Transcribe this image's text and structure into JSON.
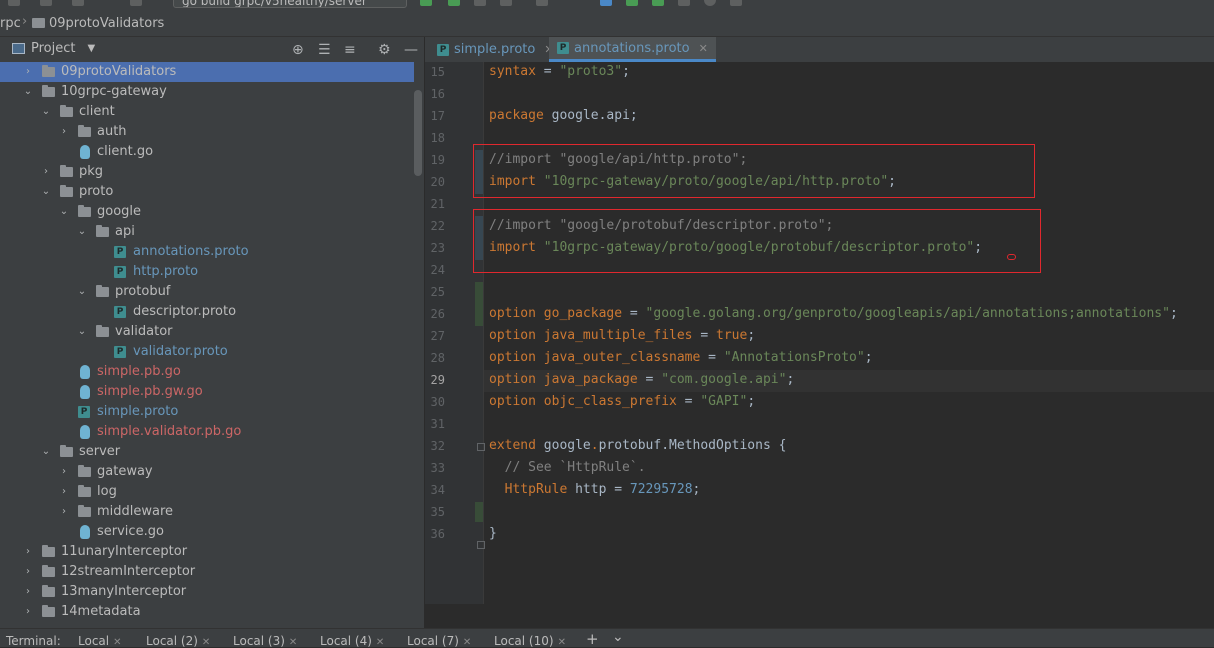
{
  "toolbar": {
    "crumb_root": "rpc",
    "crumb_folder": "09protoValidators",
    "run_config": "go build grpc/v5healthy/server"
  },
  "project_panel": {
    "title": "Project"
  },
  "tree": [
    {
      "label": "09protoValidators",
      "kind": "folder",
      "expanded": false,
      "color": "default",
      "selected": true
    },
    {
      "label": "10grpc-gateway",
      "kind": "folder",
      "expanded": true,
      "color": "default"
    },
    {
      "label": "client",
      "kind": "folder",
      "expanded": true,
      "color": "default"
    },
    {
      "label": "auth",
      "kind": "folder",
      "expanded": false,
      "color": "default"
    },
    {
      "label": "client.go",
      "kind": "go",
      "color": "default"
    },
    {
      "label": "pkg",
      "kind": "folder",
      "expanded": false,
      "color": "default"
    },
    {
      "label": "proto",
      "kind": "folder",
      "expanded": true,
      "color": "default"
    },
    {
      "label": "google",
      "kind": "folder",
      "expanded": true,
      "color": "default"
    },
    {
      "label": "api",
      "kind": "folder",
      "expanded": true,
      "color": "default"
    },
    {
      "label": "annotations.proto",
      "kind": "proto",
      "color": "blue"
    },
    {
      "label": "http.proto",
      "kind": "proto",
      "color": "blue"
    },
    {
      "label": "protobuf",
      "kind": "folder",
      "expanded": true,
      "color": "default"
    },
    {
      "label": "descriptor.proto",
      "kind": "proto",
      "color": "default"
    },
    {
      "label": "validator",
      "kind": "folder",
      "expanded": true,
      "color": "default"
    },
    {
      "label": "validator.proto",
      "kind": "proto",
      "color": "blue"
    },
    {
      "label": "simple.pb.go",
      "kind": "go",
      "color": "red"
    },
    {
      "label": "simple.pb.gw.go",
      "kind": "go",
      "color": "red"
    },
    {
      "label": "simple.proto",
      "kind": "proto",
      "color": "blue"
    },
    {
      "label": "simple.validator.pb.go",
      "kind": "go",
      "color": "red"
    },
    {
      "label": "server",
      "kind": "folder",
      "expanded": true,
      "color": "default"
    },
    {
      "label": "gateway",
      "kind": "folder",
      "expanded": false,
      "color": "default"
    },
    {
      "label": "log",
      "kind": "folder",
      "expanded": false,
      "color": "default"
    },
    {
      "label": "middleware",
      "kind": "folder",
      "expanded": false,
      "color": "default"
    },
    {
      "label": "service.go",
      "kind": "go",
      "color": "default"
    },
    {
      "label": "11unaryInterceptor",
      "kind": "folder",
      "expanded": false,
      "color": "default"
    },
    {
      "label": "12streamInterceptor",
      "kind": "folder",
      "expanded": false,
      "color": "default"
    },
    {
      "label": "13manyInterceptor",
      "kind": "folder",
      "expanded": false,
      "color": "default"
    },
    {
      "label": "14metadata",
      "kind": "folder",
      "expanded": false,
      "color": "default"
    }
  ],
  "tabs": [
    {
      "label": "simple.proto",
      "close": "✕",
      "active": false
    },
    {
      "label": "annotations.proto",
      "close": "✕",
      "active": true
    }
  ],
  "editor": {
    "line_numbers": [
      "15",
      "16",
      "17",
      "18",
      "19",
      "20",
      "21",
      "22",
      "23",
      "24",
      "25",
      "26",
      "27",
      "28",
      "29",
      "30",
      "31",
      "32",
      "33",
      "34",
      "35",
      "36"
    ],
    "current_line": "29",
    "lines": {
      "l15": {
        "kw": "syntax",
        "op": " = ",
        "str": "\"proto3\"",
        "end": ";"
      },
      "l17": {
        "kw": "package",
        "rest": " google.api;"
      },
      "l19": {
        "cmt": "//import \"google/api/http.proto\";"
      },
      "l20": {
        "kw": "import",
        "str": " \"10grpc-gateway/proto/google/api/http.proto\"",
        "end": ";"
      },
      "l22": {
        "cmt": "//import \"google/protobuf/descriptor.proto\";"
      },
      "l23": {
        "kw": "import",
        "str": " \"10grpc-gateway/proto/google/protobuf/descriptor.proto\"",
        "end": ";"
      },
      "l26": {
        "kw": "option",
        "name": " go_package",
        "op": " = ",
        "str": "\"google.golang.org/genproto/googleapis/api/annotations;annotations\"",
        "end": ";"
      },
      "l27": {
        "kw": "option",
        "name": " java_multiple_files",
        "op": " = ",
        "val": "true",
        "end": ";"
      },
      "l28": {
        "kw": "option",
        "name": " java_outer_classname",
        "op": " = ",
        "str": "\"AnnotationsProto\"",
        "end": ";"
      },
      "l29": {
        "kw": "option",
        "name": " java_package",
        "op": " = ",
        "str": "\"com.google.api\"",
        "end": ";"
      },
      "l30": {
        "kw": "option",
        "name": " objc_class_prefix",
        "op": " = ",
        "str": "\"GAPI\"",
        "end": ";"
      },
      "l32": {
        "kw": "extend",
        "a": " google",
        "b": ".",
        "c": "protobuf",
        "d": ".MethodOptions {"
      },
      "l33": {
        "cmt": "  // See `HttpRule`."
      },
      "l34": {
        "indent": "  ",
        "type": "HttpRule",
        "rest": " http = ",
        "num": "72295728",
        "end": ";"
      },
      "l36": {
        "rest": "}"
      }
    }
  },
  "terminal": {
    "label": "Terminal:",
    "tabs": [
      "Local",
      "Local (2)",
      "Local (3)",
      "Local (4)",
      "Local (7)",
      "Local (10)"
    ],
    "close": "✕",
    "add": "+",
    "more": "⌄"
  },
  "colors": {
    "selection": "#4b6eaf",
    "highlight_box": "#e0282e",
    "keyword": "#cc7832",
    "string": "#6a8759",
    "number": "#6897bb"
  }
}
